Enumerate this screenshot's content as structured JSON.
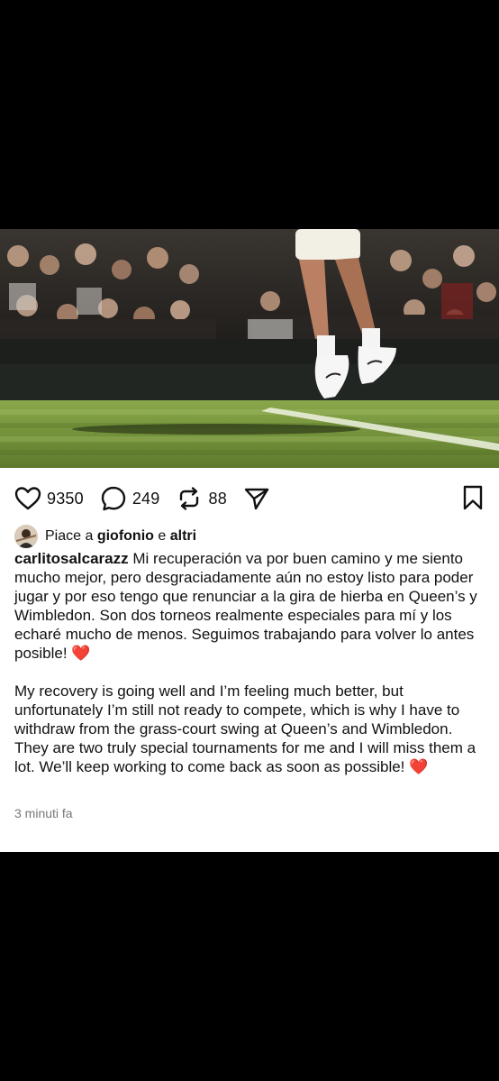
{
  "post": {
    "stats": {
      "likes": "9350",
      "comments": "249",
      "reposts": "88"
    },
    "liked_by": {
      "prefix": "Piace a",
      "user": "giofonio",
      "connector": "e",
      "others": "altri"
    },
    "author": "carlitosalcarazz",
    "caption_es": "Mi recuperación va por buen camino y me siento mucho mejor, pero desgraciadamente aún no estoy listo para poder jugar y por eso tengo que renunciar a la gira de hierba en Queen’s y Wimbledon. Son dos torneos realmente especiales para mí y los echaré mucho de menos. Seguimos trabajando para volver lo antes posible!",
    "caption_en": "My recovery is going well and I’m feeling much better, but unfortunately I’m still not ready to compete, which is why I have to withdraw from the grass-court swing at Queen’s and Wimbledon. They are two truly special tournaments for me and I will miss them a lot. We’ll keep working to come back as soon as possible!",
    "emoji": "❤️",
    "timestamp": "3 minuti fa"
  },
  "icons": {
    "like": "heart-icon",
    "comment": "comment-bubble-icon",
    "repost": "repost-icon",
    "share": "send-icon",
    "save": "bookmark-icon"
  },
  "colors": {
    "grass": "#6e8f3a",
    "text": "#111111",
    "muted": "#777777",
    "emoji_red": "#e0192e"
  }
}
